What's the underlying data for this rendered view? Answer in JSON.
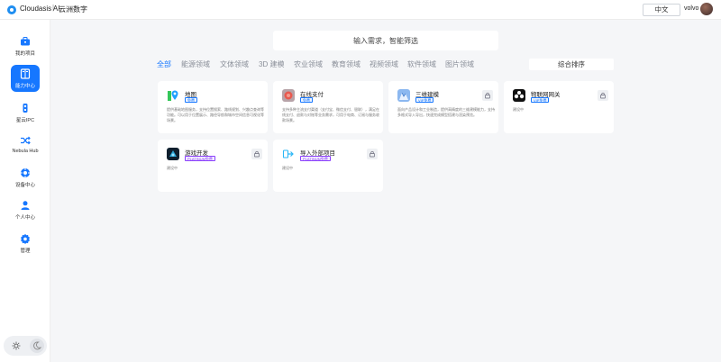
{
  "header": {
    "brand": "Cloudasis AI",
    "separator": "|",
    "subtitle": "云洲数字",
    "lang_button": "中文",
    "username": "volvo"
  },
  "sidebar": {
    "items": [
      {
        "label": "我的项目",
        "icon": "briefcase-icon"
      },
      {
        "label": "能力中心",
        "icon": "capability-icon"
      },
      {
        "label": "星云IPC",
        "icon": "ipc-icon"
      },
      {
        "label": "Nebula Hub",
        "icon": "shuffle-icon"
      },
      {
        "label": "设备中心",
        "icon": "device-icon"
      },
      {
        "label": "个人中心",
        "icon": "user-icon"
      },
      {
        "label": "管理",
        "icon": "gear-icon"
      }
    ],
    "active_index": 1
  },
  "search": {
    "placeholder": "输入需求，智能筛选"
  },
  "filters": {
    "items": [
      "全部",
      "能源领域",
      "文体领域",
      "3D 建模",
      "农业领域",
      "教育领域",
      "视频领域",
      "软件领域",
      "图片领域"
    ],
    "active": "全部"
  },
  "sort": {
    "label": "综合排序"
  },
  "cards": [
    {
      "title": "地图",
      "badge": "免费",
      "badge_color": "blue",
      "locked": false,
      "icon": "map-pin-icon",
      "desc": "提供基础地图服务，支持位置搜索、路线规划、兴趣点查询等功能。可以用于位置展示、路径导航和城市空间信息可视化等场景。"
    },
    {
      "title": "在线支付",
      "badge": "免费",
      "badge_color": "blue",
      "locked": false,
      "icon": "payment-icon",
      "desc": "支持多种主流支付渠道（支付宝、微信支付、银联），满足在线支付、退款与对账等业务需求，可用于电商、订阅与服务收款场景。"
    },
    {
      "title": "三维建模",
      "badge": "VIP免费",
      "badge_color": "blue",
      "locked": true,
      "icon": "model-3d-icon",
      "desc": "面向产品设计和工业制造，提供高精度的三维建模能力，支持多格式导入导出，快速完成模型搭建与渲染预览。"
    },
    {
      "title": "物联网网关",
      "badge": "VIP免费",
      "badge_color": "blue",
      "locked": true,
      "icon": "iot-gateway-icon",
      "desc": "建设中"
    },
    {
      "title": "游戏开发",
      "badge": "PLATINUM免费",
      "badge_color": "purple",
      "locked": true,
      "icon": "game-dev-icon",
      "desc": "建设中"
    },
    {
      "title": "导入外部项目",
      "badge": "PLATINUM免费",
      "badge_color": "purple",
      "locked": true,
      "icon": "import-icon",
      "desc": "建设中"
    }
  ],
  "colors": {
    "accent": "#1677ff",
    "vip": "#1677ff",
    "platinum": "#8a3ffc"
  }
}
